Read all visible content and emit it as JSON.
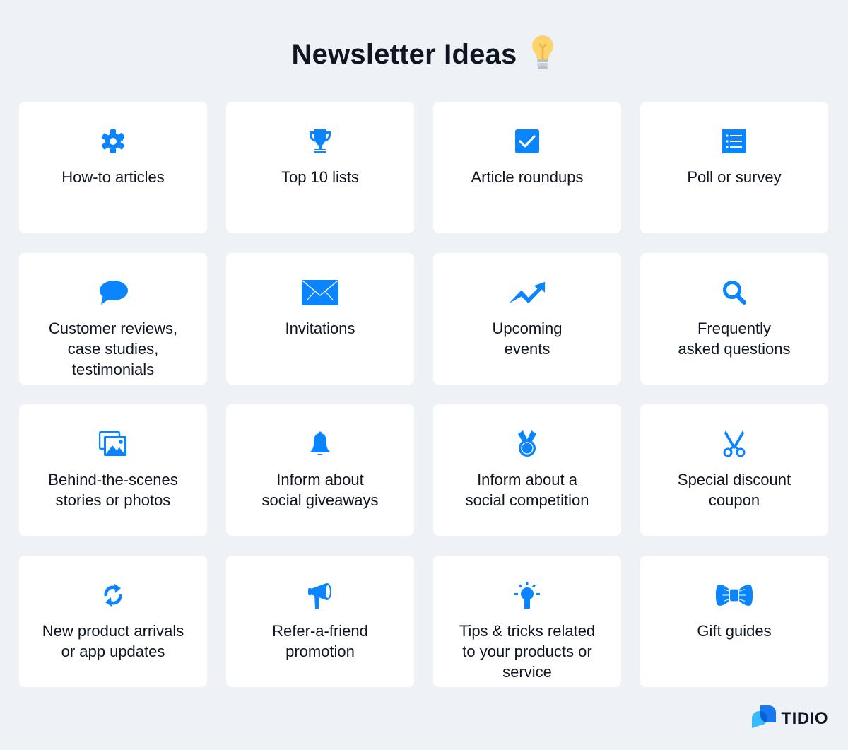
{
  "header": {
    "title": "Newsletter Ideas",
    "title_icon": "lightbulb-icon"
  },
  "colors": {
    "accent": "#0a84ff",
    "background": "#eef1f6",
    "card": "#ffffff",
    "text": "#0f1521",
    "bulb": "#fdd46b"
  },
  "ideas": [
    {
      "label": "How-to articles",
      "icon": "gear-icon"
    },
    {
      "label": "Top 10 lists",
      "icon": "trophy-icon"
    },
    {
      "label": "Article roundups",
      "icon": "checkbox-icon"
    },
    {
      "label": "Poll or survey",
      "icon": "list-icon"
    },
    {
      "label": "Customer reviews,\ncase studies,\ntestimonials",
      "icon": "chat-bubble-icon"
    },
    {
      "label": "Invitations",
      "icon": "envelope-icon"
    },
    {
      "label": "Upcoming\nevents",
      "icon": "trending-up-icon"
    },
    {
      "label": "Frequently\nasked questions",
      "icon": "search-icon"
    },
    {
      "label": "Behind-the-scenes\nstories or photos",
      "icon": "photos-icon"
    },
    {
      "label": "Inform about\nsocial giveaways",
      "icon": "bell-icon"
    },
    {
      "label": "Inform about a\nsocial competition",
      "icon": "medal-icon"
    },
    {
      "label": "Special discount\ncoupon",
      "icon": "scissors-icon"
    },
    {
      "label": "New product arrivals\nor app updates",
      "icon": "refresh-icon"
    },
    {
      "label": "Refer-a-friend\npromotion",
      "icon": "megaphone-icon"
    },
    {
      "label": "Tips & tricks related\nto your products or\nservice",
      "icon": "idea-bulb-icon"
    },
    {
      "label": "Gift guides",
      "icon": "bow-tie-icon"
    }
  ],
  "brand": {
    "name": "TIDIO",
    "icon": "tidio-logo-icon"
  }
}
